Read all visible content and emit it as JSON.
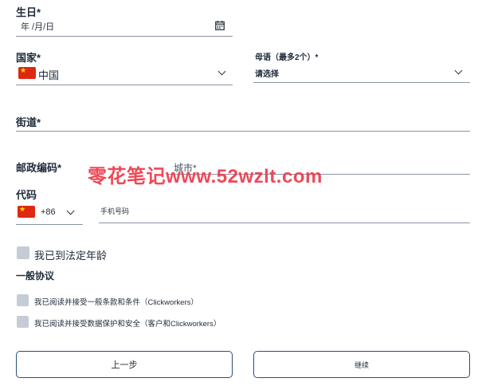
{
  "birthday": {
    "label": "生日*",
    "placeholder": "年 /月/日",
    "icon": "calendar-icon"
  },
  "country": {
    "label": "国家*",
    "value": "中国",
    "flag": "cn-flag-icon"
  },
  "native_language": {
    "label": "母语（最多2个）*",
    "value": "请选择"
  },
  "street": {
    "label": "街道*"
  },
  "postal_code": {
    "label_line1": "邮政编码*",
    "label_line2": "代码"
  },
  "city": {
    "label": "城市*"
  },
  "phone": {
    "country_code": "+86",
    "placeholder": "手机号码",
    "flag": "cn-flag-icon"
  },
  "age_confirm": {
    "label": "我已到法定年龄"
  },
  "general_agreement": {
    "heading": "一般协议",
    "items": [
      {
        "label": "我已阅读并接受一般条款和条件（Clickworkers）"
      },
      {
        "label": "我已阅读并接受数据保护和安全（客户和Clickworkers）"
      }
    ]
  },
  "buttons": {
    "back": "上一步",
    "continue": "继续"
  },
  "watermark": "零花笔记www.52wzlt.com",
  "colors": {
    "button_border": "#2b4f7a",
    "checkbox": "#c6ccd6",
    "watermark": "#ee3a4a",
    "flag_red": "#de2910"
  }
}
